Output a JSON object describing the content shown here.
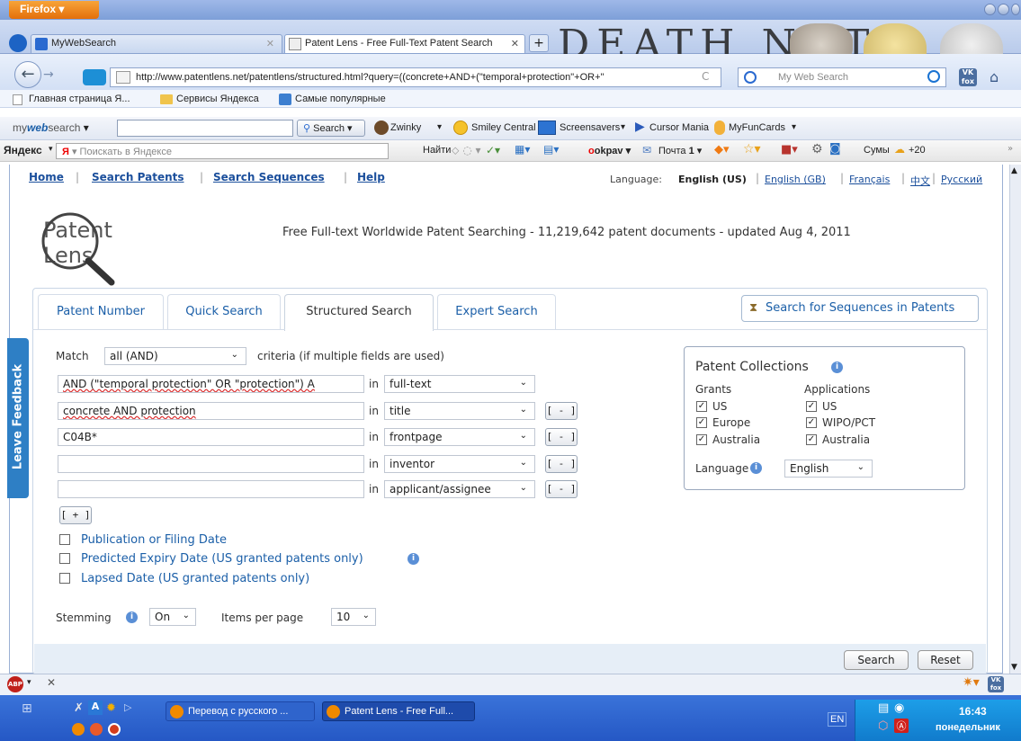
{
  "browser": {
    "menu_button": "Firefox ▾",
    "tabs": [
      {
        "label": "MyWebSearch"
      },
      {
        "label": "Patent Lens - Free Full-Text Patent Search"
      }
    ],
    "url": "http://www.patentlens.net/patentlens/structured.html?query=((concrete+AND+(\"temporal+protection\"+OR+\"",
    "search_placeholder": "My Web Search",
    "bookmarks": [
      "Главная страница Я...",
      "Сервисы Яндекса",
      "Самые популярные"
    ],
    "theme_text": "DEATH NOTE"
  },
  "mywebsearch_toolbar": {
    "brand_my": "my",
    "brand_web": "web",
    "brand_search": "search",
    "search_button": "Search",
    "items": [
      "Zwinky",
      "Smiley Central",
      "Screensavers",
      "Cursor Mania",
      "MyFunCards"
    ]
  },
  "yandex_toolbar": {
    "brand": "Яндекс",
    "search_placeholder": "Поискать в Яндексе",
    "find": "Найти",
    "user": "okpav",
    "mail": "Почта",
    "mail_count": "1",
    "city": "Сумы",
    "temp": "+20"
  },
  "site": {
    "nav": [
      "Home",
      "Search Patents",
      "Search Sequences",
      "Help"
    ],
    "language_label": "Language:",
    "language_current": "English (US)",
    "languages": [
      "English (GB)",
      "Français",
      "中文",
      "Русский"
    ],
    "logo_text": "Patent Lens",
    "tagline": "Free Full-text Worldwide Patent Searching - 11,219,642 patent documents - updated Aug 4, 2011",
    "feedback": "Leave Feedback"
  },
  "search": {
    "tabs": [
      "Patent Number",
      "Quick Search",
      "Structured Search",
      "Expert Search"
    ],
    "active_tab": "Structured Search",
    "sequences_button": "Search for Sequences in Patents",
    "match_label": "Match",
    "match_value": "all (AND)",
    "match_suffix": "criteria (if multiple fields are used)",
    "in_label": "in",
    "rows": [
      {
        "value": "AND (\"temporal protection\" OR \"protection\") A",
        "field": "full-text"
      },
      {
        "value": "concrete AND protection",
        "field": "title"
      },
      {
        "value": "C04B*",
        "field": "frontpage"
      },
      {
        "value": "",
        "field": "inventor"
      },
      {
        "value": "",
        "field": "applicant/assignee"
      }
    ],
    "remove_button": "[ - ]",
    "add_button": "[ + ]",
    "date_options": [
      "Publication or Filing Date",
      "Predicted Expiry Date (US granted patents only)",
      "Lapsed Date (US granted patents only)"
    ],
    "stemming_label": "Stemming",
    "stemming_value": "On",
    "items_label": "Items per page",
    "items_value": "10",
    "search_button": "Search",
    "reset_button": "Reset"
  },
  "collections": {
    "title": "Patent Collections",
    "grants_label": "Grants",
    "applications_label": "Applications",
    "grants": [
      "US",
      "Europe",
      "Australia"
    ],
    "applications": [
      "US",
      "WIPO/PCT",
      "Australia"
    ],
    "language_label": "Language",
    "language_value": "English"
  },
  "taskbar": {
    "tasks": [
      "Перевод с русского ...",
      "Patent Lens - Free Full..."
    ],
    "lang": "EN",
    "time": "16:43",
    "day": "понедельник"
  },
  "colors": {
    "link": "#1b5fa8",
    "feedback": "#2e7fc5",
    "taskbar": "#2558c5"
  }
}
